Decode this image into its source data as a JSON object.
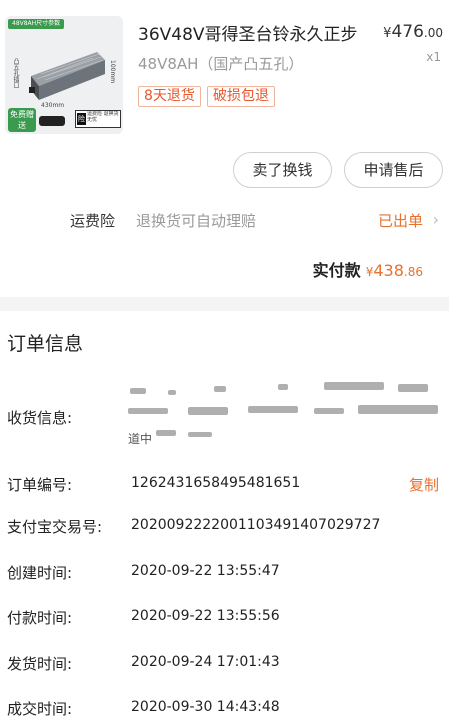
{
  "product": {
    "title": "36V48V哥得圣台铃永久正步",
    "spec": "48V8AH（国产凸五孔）",
    "price_yen": "¥",
    "price_main": "476",
    "price_cents": ".00",
    "quantity": "x1",
    "tags": [
      "8天退货",
      "破损包退"
    ],
    "thumb": {
      "header": "48V8AH尺寸参数",
      "dim_length": "430mm",
      "dim_height": "100mm",
      "side_label": "凸五孔插口",
      "free_badge": "免费赠送",
      "insurance_text": "运费险 退换货无忧",
      "insurance_mark": "险"
    }
  },
  "actions": {
    "sell": "卖了换钱",
    "after_sale": "申请售后"
  },
  "shipping_insurance": {
    "label": "运费险",
    "description": "退换货可自动理赔",
    "status": "已出单",
    "chevron": "›"
  },
  "payment": {
    "label": "实付款",
    "yen": "¥",
    "amount": "438",
    "cents": ".86"
  },
  "order_info": {
    "title": "订单信息",
    "address_label": "收货信息:",
    "address_partial": "道中",
    "order_no_label": "订单编号:",
    "order_no": "1262431658495481651",
    "copy": "复制",
    "alipay_label": "支付宝交易号:",
    "alipay_no": "2020092222001103491407029727",
    "created_label": "创建时间:",
    "created": "2020-09-22 13:55:47",
    "paid_label": "付款时间:",
    "paid": "2020-09-22 13:55:56",
    "shipped_label": "发货时间:",
    "shipped": "2020-09-24 17:01:43",
    "completed_label": "成交时间:",
    "completed": "2020-09-30 14:43:48"
  }
}
